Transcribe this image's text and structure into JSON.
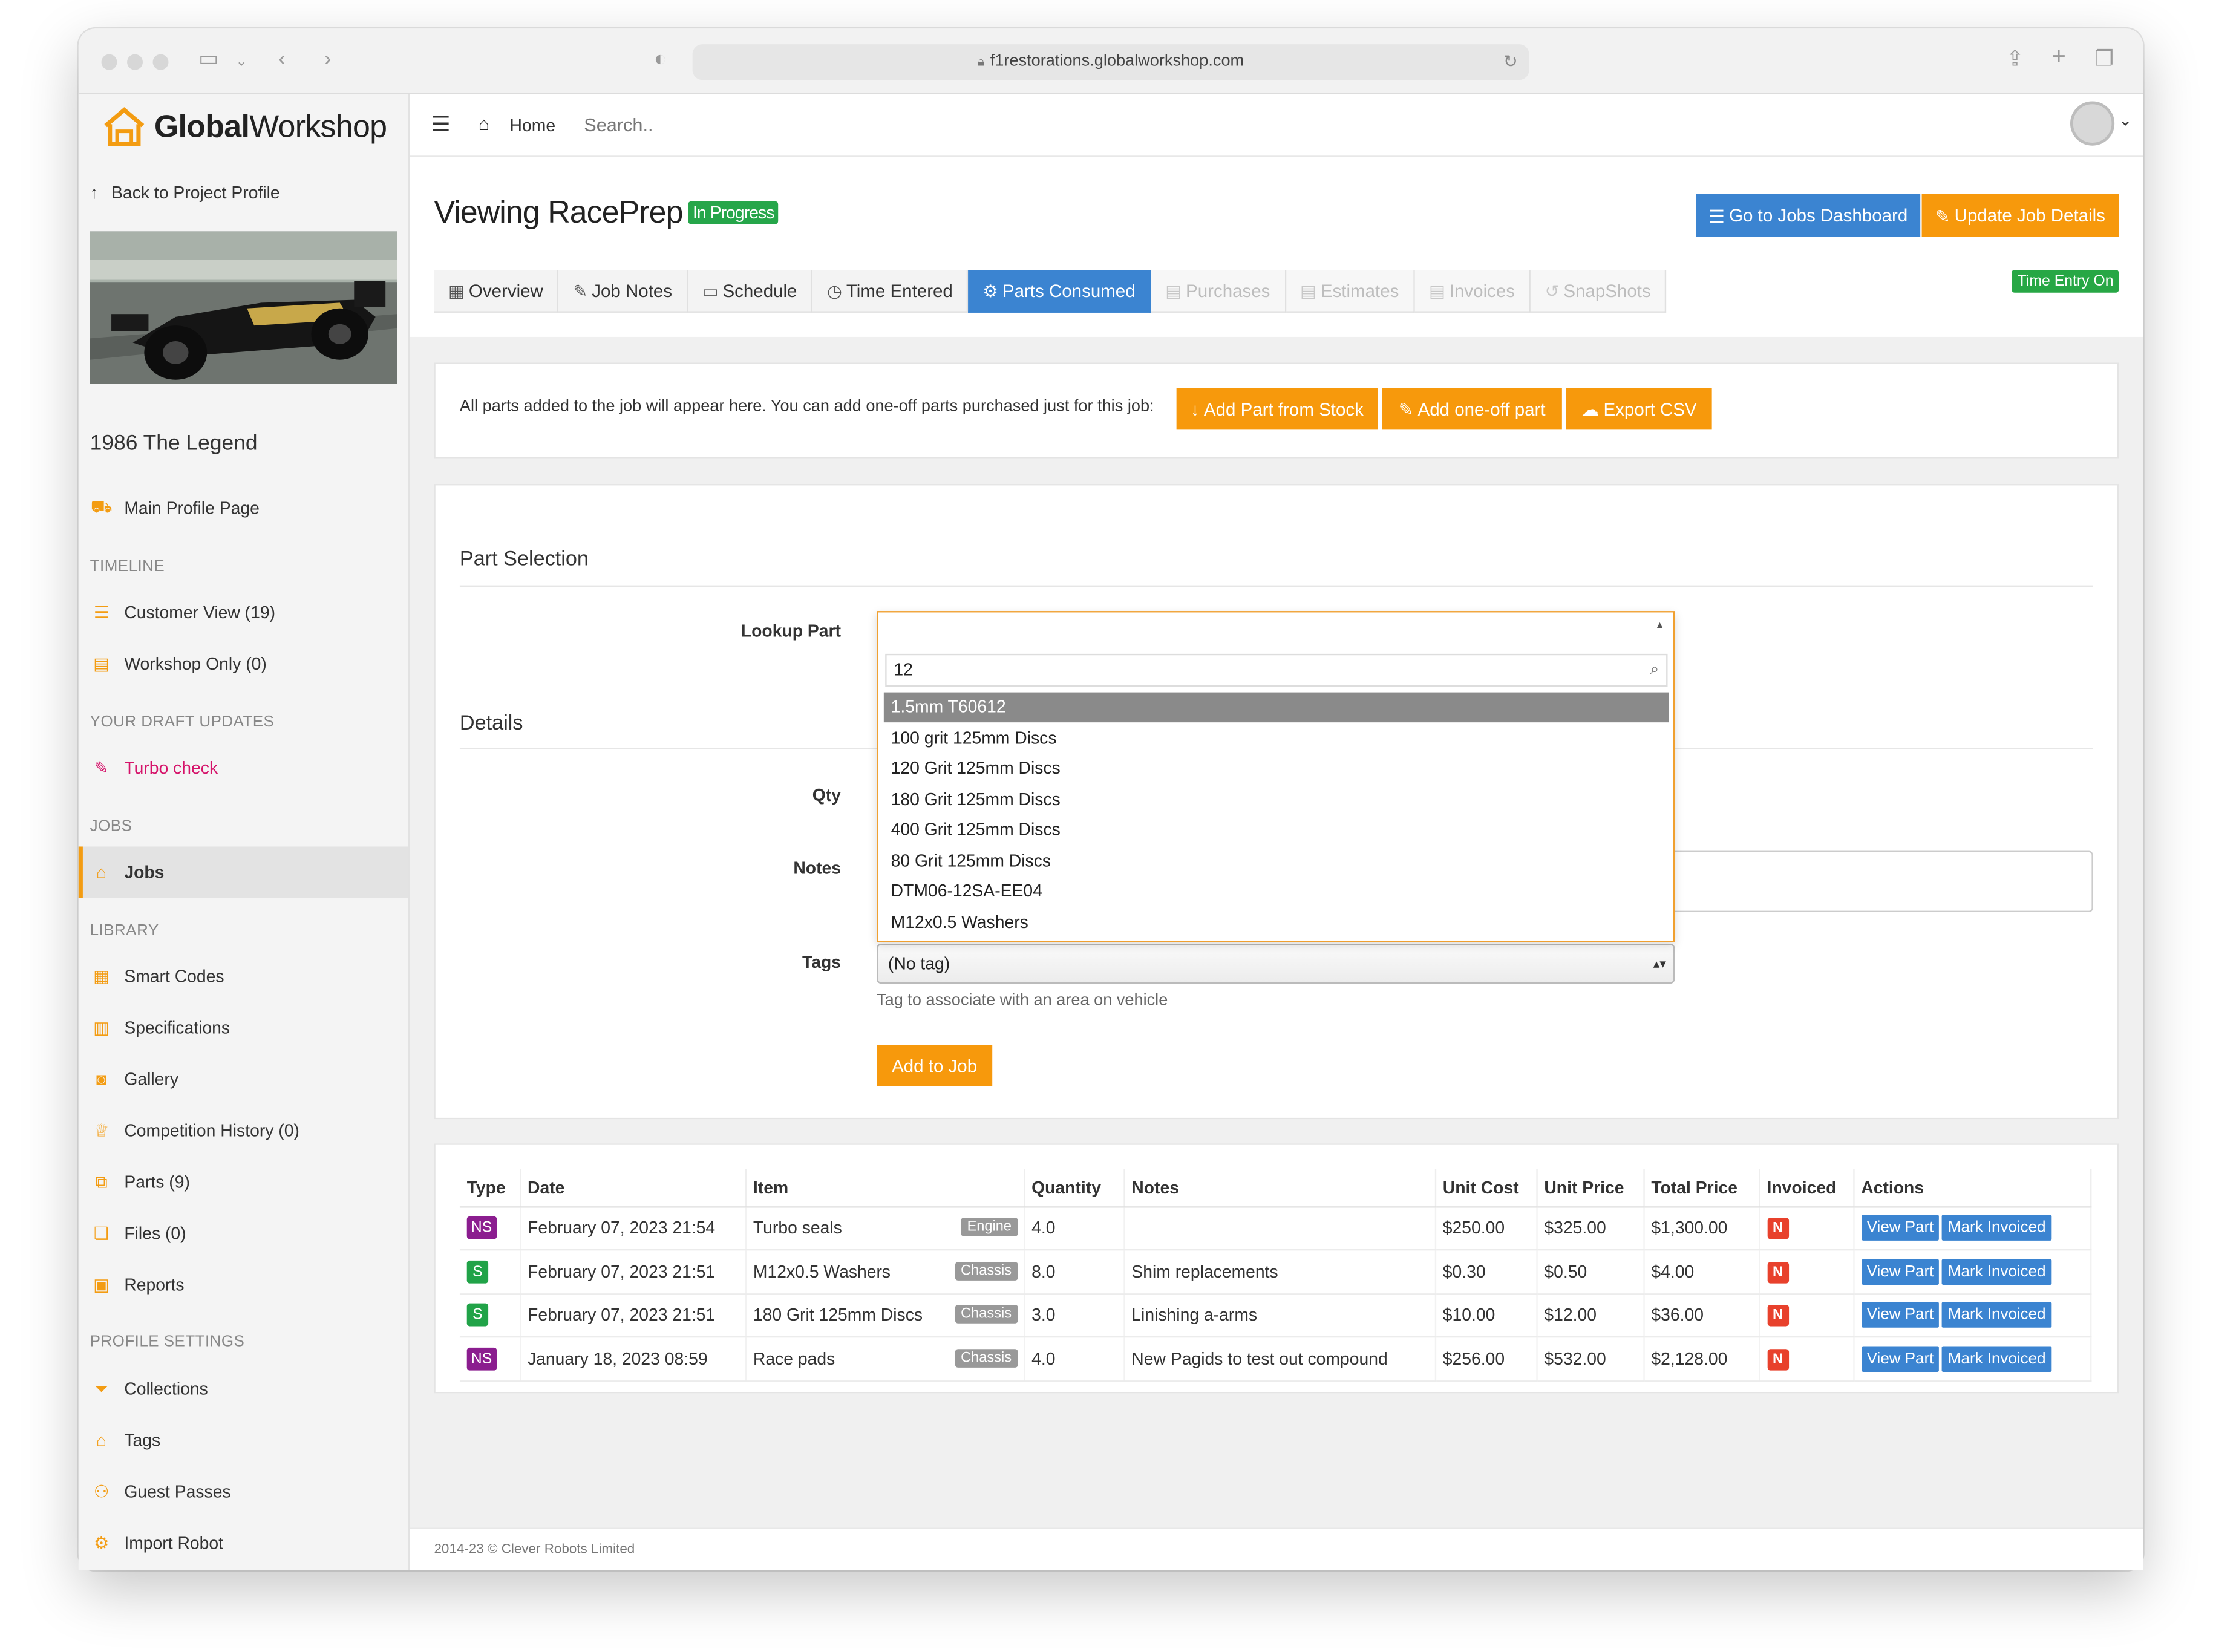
{
  "browser": {
    "url": "f1restorations.globalworkshop.com"
  },
  "brand": {
    "name_bold": "Global",
    "name_light": "Workshop",
    "accent": "#f39c12"
  },
  "sidebar": {
    "back_link": "Back to Project Profile",
    "profile_name": "1986 The Legend",
    "main_profile": "Main Profile Page",
    "timeline_head": "TIMELINE",
    "customer_view": "Customer View (19)",
    "workshop_only": "Workshop Only (0)",
    "draft_head": "YOUR DRAFT UPDATES",
    "turbo_check": "Turbo check",
    "jobs_head": "JOBS",
    "jobs": "Jobs",
    "library_head": "LIBRARY",
    "smart_codes": "Smart Codes",
    "specifications": "Specifications",
    "gallery": "Gallery",
    "competition_history": "Competition History (0)",
    "parts": "Parts (9)",
    "files": "Files (0)",
    "reports": "Reports",
    "profile_settings_head": "PROFILE SETTINGS",
    "collections": "Collections",
    "tags": "Tags",
    "guest_passes": "Guest Passes",
    "import_robot": "Import Robot"
  },
  "topbar": {
    "home": "Home",
    "search_placeholder": "Search.."
  },
  "header": {
    "title": "Viewing RacePrep",
    "status": "In Progress",
    "jobs_dashboard": "Go to Jobs Dashboard",
    "update_job": "Update Job Details",
    "time_entry": "Time Entry On"
  },
  "tabs": {
    "overview": "Overview",
    "job_notes": "Job Notes",
    "schedule": "Schedule",
    "time_entered": "Time Entered",
    "parts_consumed": "Parts Consumed",
    "purchases": "Purchases",
    "estimates": "Estimates",
    "invoices": "Invoices",
    "snapshots": "SnapShots"
  },
  "intro": {
    "text": "All parts added to the job will appear here. You can add one-off parts purchased just for this job:",
    "add_from_stock": "Add Part from Stock",
    "add_one_off": "Add one-off part",
    "export_csv": "Export CSV"
  },
  "form": {
    "part_selection": "Part Selection",
    "lookup_label": "Lookup Part",
    "search_value": "12",
    "options": [
      "1.5mm T60612",
      "100 grit 125mm Discs",
      "120 Grit 125mm Discs",
      "180 Grit 125mm Discs",
      "400 Grit 125mm Discs",
      "80 Grit 125mm Discs",
      "DTM06-12SA-EE04",
      "M12x0.5 Washers"
    ],
    "details": "Details",
    "qty_label": "Qty",
    "notes_label": "Notes",
    "tags_label": "Tags",
    "tag_value": "(No tag)",
    "tag_help": "Tag to associate with an area on vehicle",
    "add_to_job": "Add to Job"
  },
  "table": {
    "headers": [
      "Type",
      "Date",
      "Item",
      "Quantity",
      "Notes",
      "Unit Cost",
      "Unit Price",
      "Total Price",
      "Invoiced",
      "Actions"
    ],
    "rows": [
      {
        "type": "NS",
        "date": "February 07, 2023 21:54",
        "item": "Turbo seals",
        "tag": "Engine",
        "qty": "4.0",
        "notes": "",
        "unit_cost": "$250.00",
        "unit_price": "$325.00",
        "total": "$1,300.00",
        "invoiced": "N"
      },
      {
        "type": "S",
        "date": "February 07, 2023 21:51",
        "item": "M12x0.5 Washers",
        "tag": "Chassis",
        "qty": "8.0",
        "notes": "Shim replacements",
        "unit_cost": "$0.30",
        "unit_price": "$0.50",
        "total": "$4.00",
        "invoiced": "N"
      },
      {
        "type": "S",
        "date": "February 07, 2023 21:51",
        "item": "180 Grit 125mm Discs",
        "tag": "Chassis",
        "qty": "3.0",
        "notes": "Linishing a-arms",
        "unit_cost": "$10.00",
        "unit_price": "$12.00",
        "total": "$36.00",
        "invoiced": "N"
      },
      {
        "type": "NS",
        "date": "January 18, 2023 08:59",
        "item": "Race pads",
        "tag": "Chassis",
        "qty": "4.0",
        "notes": "New Pagids to test out compound",
        "unit_cost": "$256.00",
        "unit_price": "$532.00",
        "total": "$2,128.00",
        "invoiced": "N"
      }
    ],
    "view_part": "View Part",
    "mark_invoiced": "Mark Invoiced"
  },
  "footer": {
    "text": "2014-23 © Clever Robots Limited"
  }
}
